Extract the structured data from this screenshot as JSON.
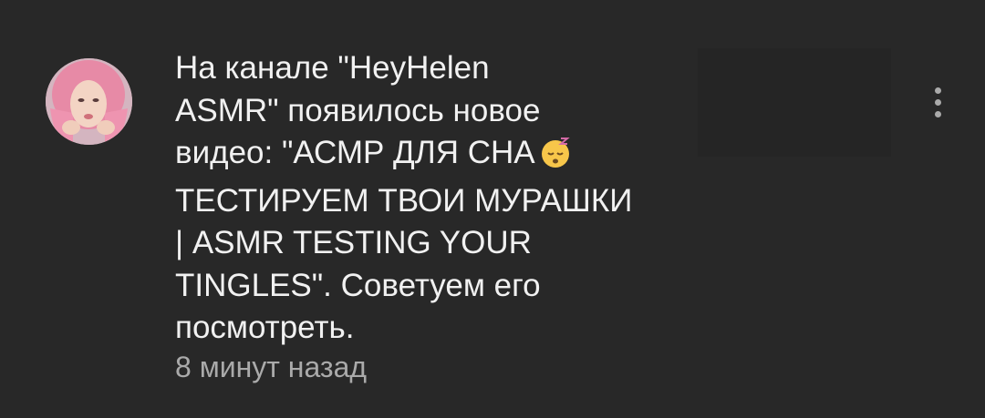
{
  "notification": {
    "channel_avatar": "channel-avatar-image",
    "message_before_emoji": "На канале \"HeyHelen\nASMR\" появилось новое\nвидео: \"АСМР ДЛЯ СНА",
    "emoji": "sleeping-face-emoji",
    "message_after_emoji": "\nТЕСТИРУЕМ ТВОИ МУРАШКИ\n| ASMR TESTING YOUR\nTINGLES\". Советуем его\nпосмотреть.",
    "timestamp": "8 минут назад",
    "thumbnail": "video-thumbnail-placeholder",
    "menu_icon": "more-vertical-icon"
  },
  "colors": {
    "background": "#282828",
    "primary_text": "#f1f1f1",
    "secondary_text": "#aaaaaa",
    "thumbnail_bg": "#252525"
  }
}
